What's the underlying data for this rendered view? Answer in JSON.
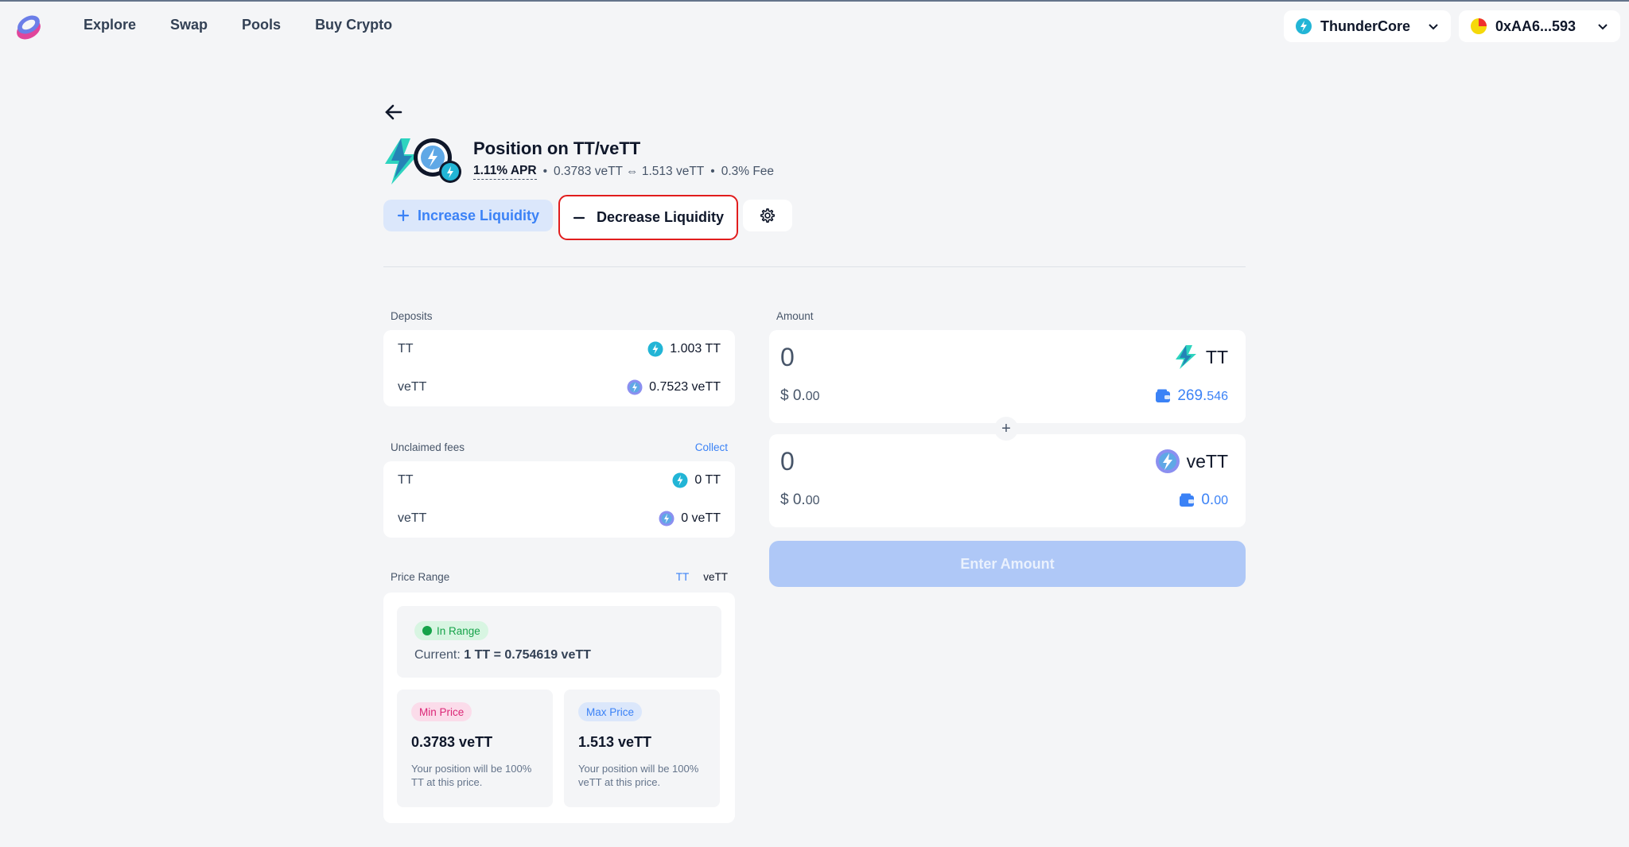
{
  "nav": {
    "items": [
      "Explore",
      "Swap",
      "Pools",
      "Buy Crypto"
    ]
  },
  "header": {
    "network": "ThunderCore",
    "account": "0xAA6...593"
  },
  "position": {
    "title": "Position on TT/veTT",
    "apr": "1.11% APR",
    "range_text": "0.3783 veTT ⇔ 1.513 veTT",
    "fee": "0.3% Fee"
  },
  "actions": {
    "increase": "Increase Liquidity",
    "decrease": "Decrease Liquidity"
  },
  "deposits": {
    "label": "Deposits",
    "rows": [
      {
        "token": "TT",
        "value": "1.003 TT"
      },
      {
        "token": "veTT",
        "value": "0.7523 veTT"
      }
    ]
  },
  "fees": {
    "label": "Unclaimed fees",
    "collect": "Collect",
    "rows": [
      {
        "token": "TT",
        "value": "0 TT"
      },
      {
        "token": "veTT",
        "value": "0 veTT"
      }
    ]
  },
  "price_range": {
    "label": "Price Range",
    "toggle": [
      "TT",
      "veTT"
    ],
    "status": "In Range",
    "current_prefix": "Current:",
    "current_value": "1 TT = 0.754619 veTT",
    "min": {
      "badge": "Min Price",
      "value": "0.3783 veTT",
      "note": "Your position will be 100% TT at this price."
    },
    "max": {
      "badge": "Max Price",
      "value": "1.513 veTT",
      "note": "Your position will be 100% veTT at this price."
    }
  },
  "amount": {
    "label": "Amount",
    "inputs": [
      {
        "value": "0",
        "usd_main": "$ 0.",
        "usd_dec": "00",
        "token": "TT",
        "bal_main": "269.",
        "bal_dec": "546"
      },
      {
        "value": "0",
        "usd_main": "$ 0.",
        "usd_dec": "00",
        "token": "veTT",
        "bal_main": "0.",
        "bal_dec": "00"
      }
    ],
    "plus": "+",
    "button": "Enter Amount"
  },
  "colors": {
    "accent": "#3b82f6",
    "danger_outline": "#e11d1d",
    "in_range": "#16a34a"
  }
}
